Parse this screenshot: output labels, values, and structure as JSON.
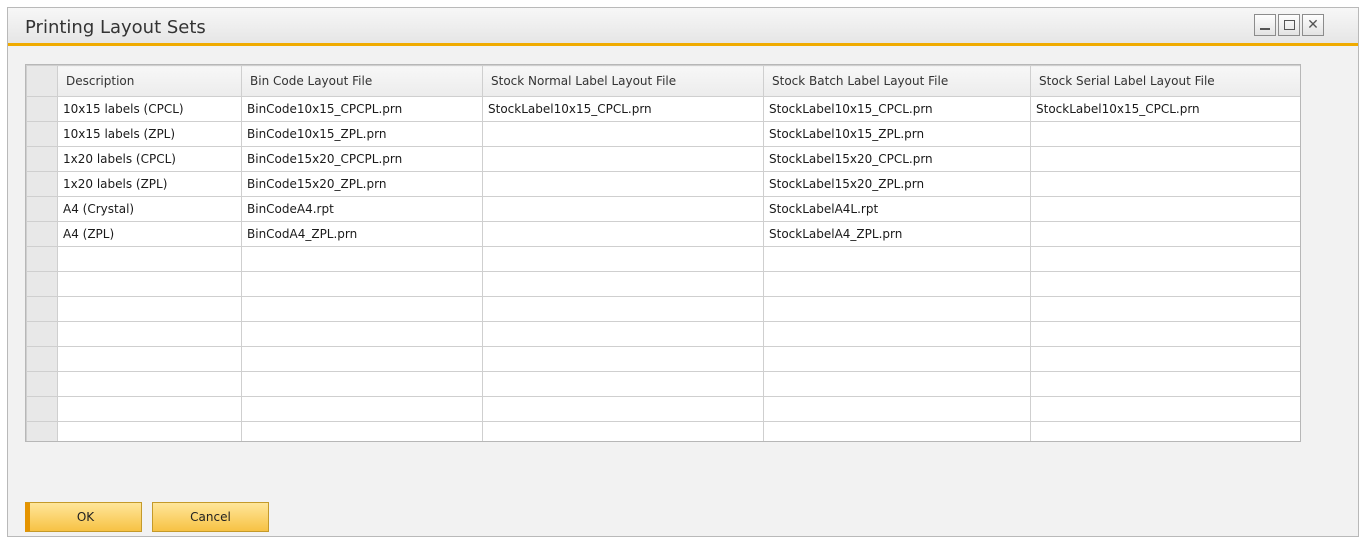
{
  "window": {
    "title": "Printing Layout Sets"
  },
  "grid": {
    "columns": [
      "Description",
      "Bin Code Layout File",
      "Stock Normal Label Layout File",
      "Stock Batch Label Layout File",
      "Stock Serial Label Layout File"
    ],
    "rows": [
      [
        "10x15 labels (CPCL)",
        "BinCode10x15_CPCPL.prn",
        "StockLabel10x15_CPCL.prn",
        "StockLabel10x15_CPCL.prn",
        "StockLabel10x15_CPCL.prn"
      ],
      [
        "10x15 labels (ZPL)",
        "BinCode10x15_ZPL.prn",
        "",
        "StockLabel10x15_ZPL.prn",
        ""
      ],
      [
        "1x20 labels (CPCL)",
        "BinCode15x20_CPCPL.prn",
        "",
        "StockLabel15x20_CPCL.prn",
        ""
      ],
      [
        "1x20 labels (ZPL)",
        "BinCode15x20_ZPL.prn",
        "",
        "StockLabel15x20_ZPL.prn",
        ""
      ],
      [
        "A4 (Crystal)",
        "BinCodeA4.rpt",
        "",
        "StockLabelA4L.rpt",
        ""
      ],
      [
        "A4 (ZPL)",
        "BinCodA4_ZPL.prn",
        "",
        "StockLabelA4_ZPL.prn",
        ""
      ],
      [
        "",
        "",
        "",
        "",
        ""
      ],
      [
        "",
        "",
        "",
        "",
        ""
      ],
      [
        "",
        "",
        "",
        "",
        ""
      ],
      [
        "",
        "",
        "",
        "",
        ""
      ],
      [
        "",
        "",
        "",
        "",
        ""
      ],
      [
        "",
        "",
        "",
        "",
        ""
      ],
      [
        "",
        "",
        "",
        "",
        ""
      ],
      [
        "",
        "",
        "",
        "",
        ""
      ]
    ]
  },
  "buttons": {
    "ok": "OK",
    "cancel": "Cancel"
  },
  "colors": {
    "accent": "#f0ab00",
    "button_fill": "#f7c244"
  },
  "icons": {
    "minimize": "minimize-icon",
    "maximize": "maximize-icon",
    "close": "close-icon"
  }
}
